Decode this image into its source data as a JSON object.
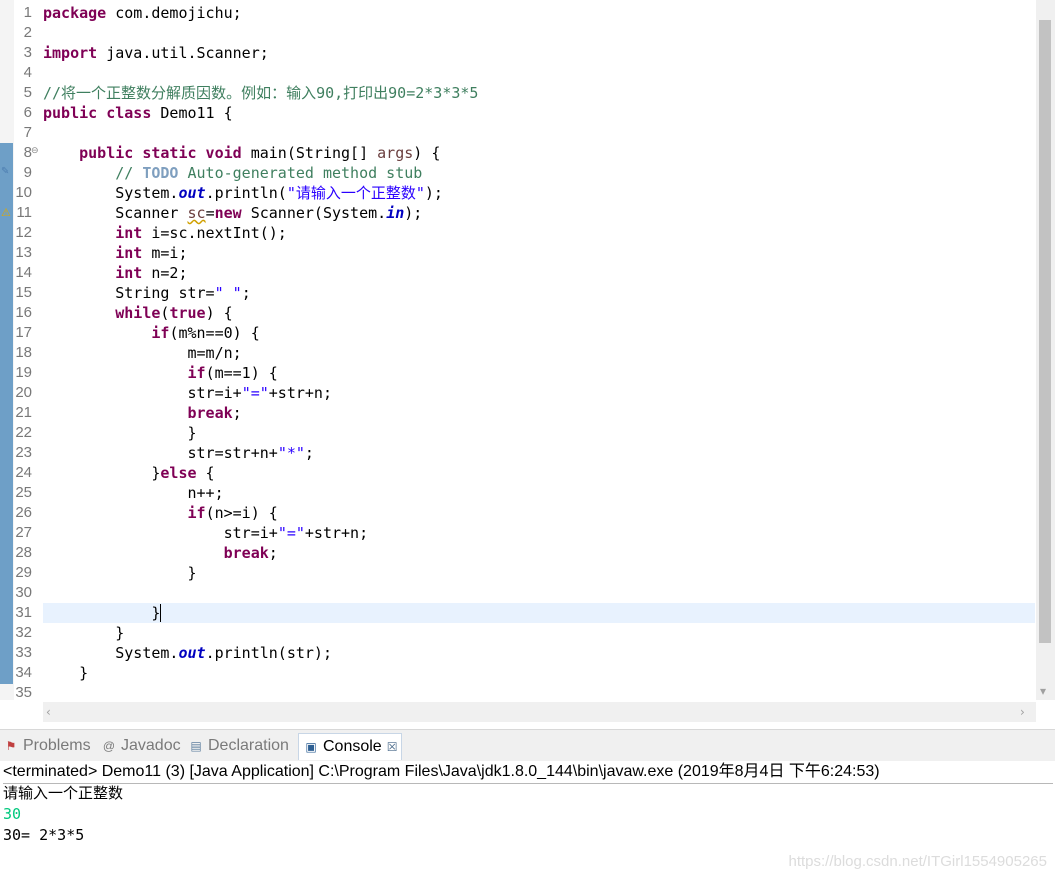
{
  "editor": {
    "line_numbers": [
      "1",
      "2",
      "3",
      "4",
      "5",
      "6",
      "7",
      "8",
      "9",
      "10",
      "11",
      "12",
      "13",
      "14",
      "15",
      "16",
      "17",
      "18",
      "19",
      "20",
      "21",
      "22",
      "23",
      "24",
      "25",
      "26",
      "27",
      "28",
      "29",
      "30",
      "31",
      "32",
      "33",
      "34",
      "35"
    ],
    "lines": {
      "l1_kw": "package",
      "l1_rest": " com.demojichu;",
      "l3_kw": "import",
      "l3_rest": " java.util.Scanner;",
      "l5": "//将一个正整数分解质因数。例如：输入90,打印出90=2*3*3*5",
      "l6_kw": "public class",
      "l6_rest": " Demo11 {",
      "l8_indent": "    ",
      "l8_kw": "public static void",
      "l8_a": " main(String[] ",
      "l8_var": "args",
      "l8_b": ") {",
      "l9_a": "        // ",
      "l9_todo": "TODO",
      "l9_b": " Auto-generated method stub",
      "l10_a": "        System.",
      "l10_fld": "out",
      "l10_b": ".println(",
      "l10_str": "\"请输入一个正整数\"",
      "l10_c": ");",
      "l11_a": "        Scanner ",
      "l11_var": "sc",
      "l11_b": "=",
      "l11_kw": "new",
      "l11_c": " Scanner(System.",
      "l11_fld": "in",
      "l11_d": ");",
      "l12_a": "        ",
      "l12_kw": "int",
      "l12_b": " i=sc.nextInt();",
      "l13_a": "        ",
      "l13_kw": "int",
      "l13_b": " m=i;",
      "l14_a": "        ",
      "l14_kw": "int",
      "l14_b": " n=2;",
      "l15_a": "        String str=",
      "l15_str": "\" \"",
      "l15_b": ";",
      "l16_a": "        ",
      "l16_kw": "while",
      "l16_b": "(",
      "l16_kw2": "true",
      "l16_c": ") {",
      "l17_a": "            ",
      "l17_kw": "if",
      "l17_b": "(m%n==0) {",
      "l18": "                m=m/n;",
      "l19_a": "                ",
      "l19_kw": "if",
      "l19_b": "(m==1) {",
      "l20_a": "                str=i+",
      "l20_str": "\"=\"",
      "l20_b": "+str+n;",
      "l21_a": "                ",
      "l21_kw": "break",
      "l21_b": ";",
      "l22": "                }",
      "l23_a": "                str=str+n+",
      "l23_str": "\"*\"",
      "l23_b": ";",
      "l24_a": "            }",
      "l24_kw": "else",
      "l24_b": " {",
      "l25": "                n++;",
      "l26_a": "                ",
      "l26_kw": "if",
      "l26_b": "(n>=i) {",
      "l27_a": "                    str=i+",
      "l27_str": "\"=\"",
      "l27_b": "+str+n;",
      "l28_a": "                    ",
      "l28_kw": "break",
      "l28_b": ";",
      "l29": "                }",
      "l31": "            }",
      "l32": "        }",
      "l33_a": "        System.",
      "l33_fld": "out",
      "l33_b": ".println(str);",
      "l34": "    }"
    }
  },
  "panel": {
    "tabs": [
      {
        "label": "Problems",
        "icon": "problems-icon"
      },
      {
        "label": "Javadoc",
        "icon": "javadoc-icon"
      },
      {
        "label": "Declaration",
        "icon": "declaration-icon"
      },
      {
        "label": "Console",
        "icon": "console-icon",
        "active": true
      }
    ],
    "close_glyph": "☒"
  },
  "console": {
    "status": "<terminated> Demo11 (3) [Java Application] C:\\Program Files\\Java\\jdk1.8.0_144\\bin\\javaw.exe (2019年8月4日 下午6:24:53)",
    "output": [
      "请输入一个正整数",
      "30",
      "30= 2*3*5"
    ],
    "input_color": "#00c87d"
  },
  "watermark": "https://blog.csdn.net/ITGirl1554905265"
}
